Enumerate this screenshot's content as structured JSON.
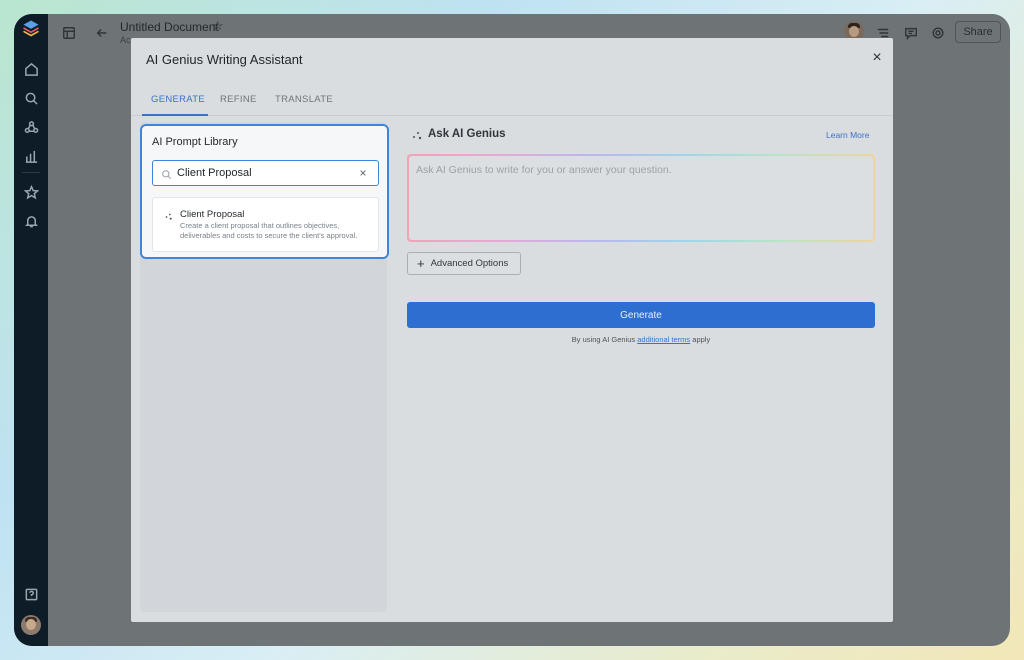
{
  "document": {
    "title": "Untitled Document",
    "subtitle": "Ac",
    "share_label": "Share"
  },
  "modal": {
    "title": "AI Genius Writing Assistant",
    "close_glyph": "×",
    "tabs": [
      {
        "label": "GENERATE",
        "active": true
      },
      {
        "label": "REFINE",
        "active": false
      },
      {
        "label": "TRANSLATE",
        "active": false
      }
    ]
  },
  "library": {
    "title": "AI Prompt Library",
    "search_value": "Client Proposal",
    "clear_glyph": "×",
    "results": [
      {
        "title": "Client Proposal",
        "description": "Create a client proposal that outlines objectives, deliverables and costs to secure the client's approval."
      }
    ]
  },
  "assistant": {
    "heading": "Ask AI Genius",
    "learn_more": "Learn More",
    "prompt_placeholder": "Ask AI Genius to write for you or answer your question.",
    "advanced_label": "Advanced Options",
    "advanced_glyph": "+",
    "generate_label": "Generate",
    "terms_prefix": "By using AI Genius",
    "terms_link": "additional terms",
    "terms_suffix": "apply"
  },
  "colors": {
    "accent": "#3c86e0",
    "primary_button": "#2c6fd1",
    "rail": "#0e1c27"
  }
}
